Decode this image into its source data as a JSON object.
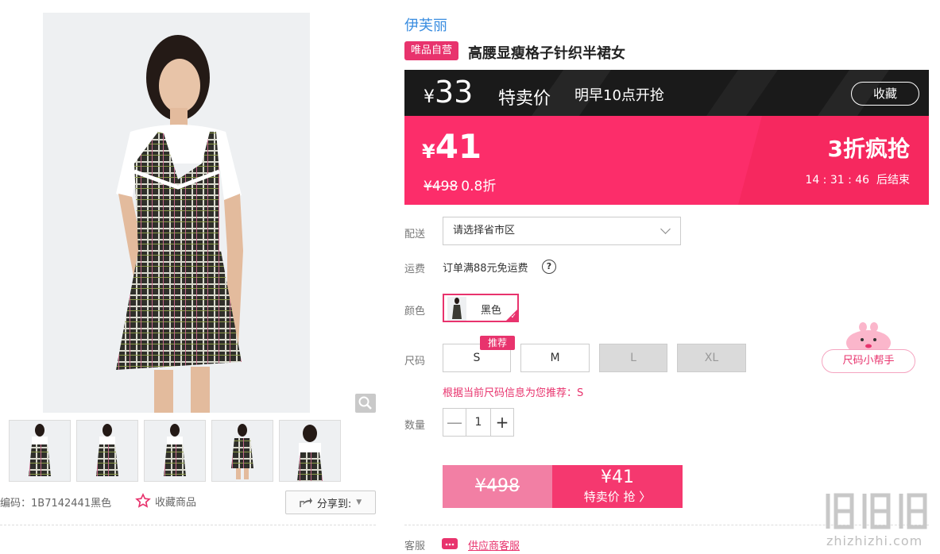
{
  "brand": "伊芙丽",
  "tag": "唯品自营",
  "title": "高腰显瘦格子针织半裙女",
  "preview": {
    "currency": "¥",
    "price": "33",
    "label": "特卖价",
    "time_note": "明早10点开抢",
    "fav_label": "收藏"
  },
  "flash": {
    "currency": "¥",
    "price": "41",
    "orig_price": "¥498",
    "discount_text": "0.8折",
    "promo": "3折疯抢",
    "countdown": "14 : 31 : 46",
    "countdown_suffix": "后结束"
  },
  "delivery": {
    "label": "配送",
    "placeholder": "请选择省市区"
  },
  "shipping": {
    "label": "运费",
    "text": "订单满88元免运费",
    "help": "?"
  },
  "color": {
    "label": "颜色",
    "selected": "黑色",
    "check": "✓"
  },
  "size": {
    "label": "尺码",
    "badge": "推荐",
    "options": [
      {
        "label": "S"
      },
      {
        "label": "M"
      },
      {
        "label": "L"
      },
      {
        "label": "XL"
      }
    ],
    "recommend_text": "根据当前尺码信息为您推荐：S"
  },
  "helper": {
    "label": "尺码小帮手"
  },
  "quantity": {
    "label": "数量",
    "value": "1",
    "minus": "—",
    "plus": "+"
  },
  "buy": {
    "orig_price": "¥498",
    "price": "¥41",
    "action": "特卖价 抢 〉"
  },
  "service": {
    "label": "客服",
    "link": "供应商客服"
  },
  "gallery": {
    "sku": "编码：1B7142441黑色",
    "fav": "收藏商品",
    "share": "分享到:"
  },
  "watermark": {
    "url": "zhizhizhi.com"
  },
  "colors": {
    "accent": "#e8336d",
    "flash_bg": "#fc2d6a",
    "brand_link": "#3a8de0"
  }
}
